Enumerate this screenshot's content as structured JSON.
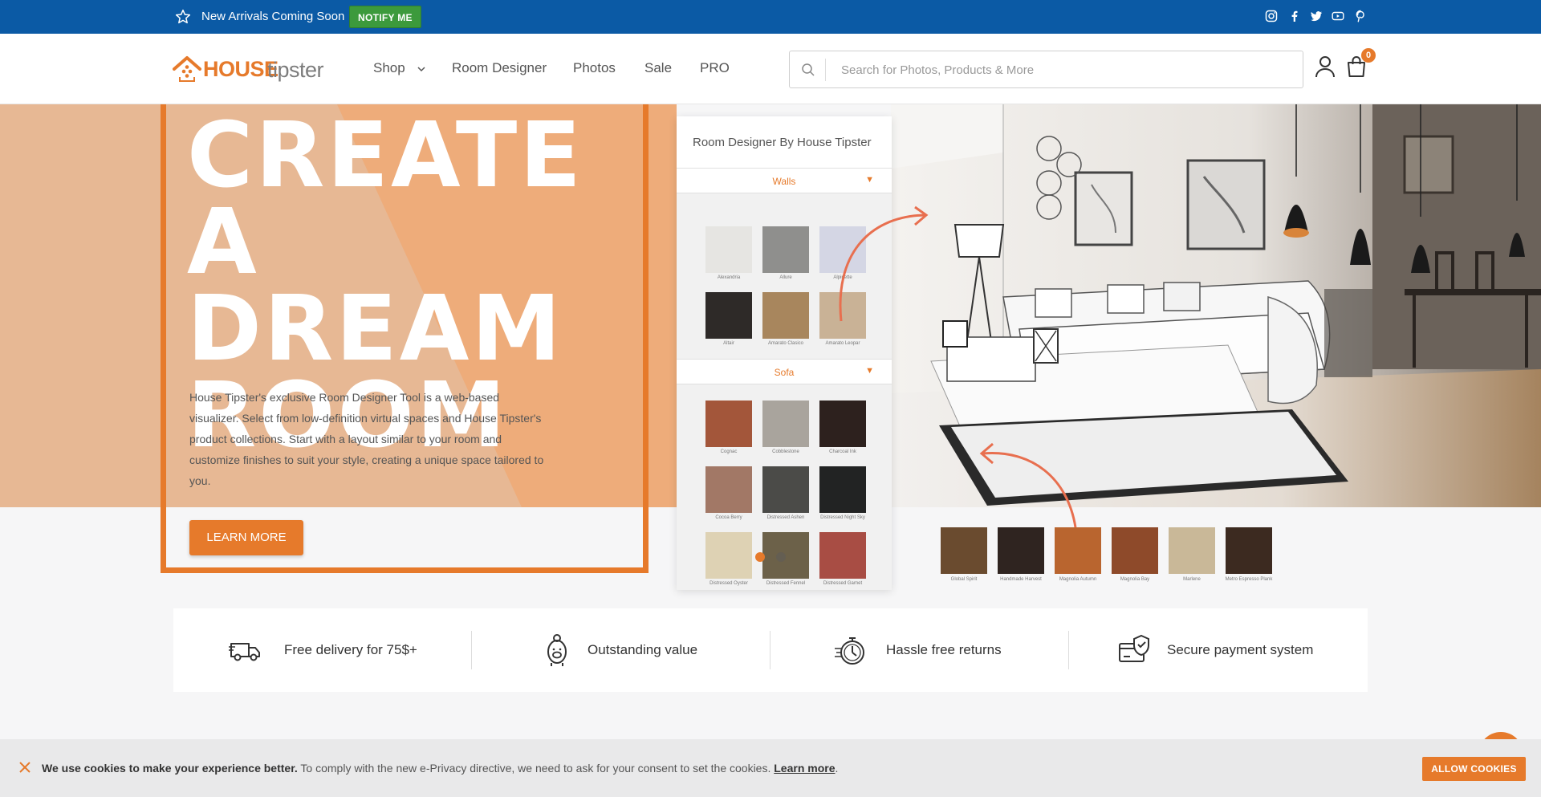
{
  "topbar": {
    "promo_text": "New Arrivals Coming Soon",
    "notify_label": "NOTIFY ME",
    "social": [
      "instagram-icon",
      "facebook-icon",
      "twitter-icon",
      "youtube-icon",
      "pinterest-icon"
    ],
    "bg_color": "#0b5aa5"
  },
  "header": {
    "logo_house": "HOUSE",
    "logo_tipster": "tipster",
    "nav": [
      "Shop",
      "Room Designer",
      "Photos",
      "Sale",
      "PRO"
    ],
    "search_placeholder": "Search for Photos, Products & More",
    "cart_count": "0",
    "accent_color": "#e67a2b"
  },
  "hero": {
    "headline": [
      "CREATE",
      "A DREAM",
      "ROOM"
    ],
    "description": "House Tipster's exclusive Room Designer Tool is a web-based visualizer. Select from low-definition virtual spaces and House Tipster's product collections. Start with a layout similar to your room and customize finishes to suit your style, creating a unique space tailored to you.",
    "cta_label": "LEARN MORE"
  },
  "designer": {
    "title": "Room Designer By House Tipster",
    "walls_label": "Walls",
    "walls": [
      {
        "name": "Alexandria",
        "color": "#e6e5e2"
      },
      {
        "name": "Allure",
        "color": "#8f8f8d"
      },
      {
        "name": "Alpinette",
        "color": "#d4d6e4"
      },
      {
        "name": "Altair",
        "color": "#2e2a28"
      },
      {
        "name": "Amarato Clasico",
        "color": "#a8865d"
      },
      {
        "name": "Amarato Leopar",
        "color": "#c9b296"
      }
    ],
    "sofa_label": "Sofa",
    "sofas": [
      {
        "name": "Cognac",
        "color": "#a3563a"
      },
      {
        "name": "Cobblestone",
        "color": "#a9a49d"
      },
      {
        "name": "Charcoal Ink",
        "color": "#2d211e"
      },
      {
        "name": "Cocoa Berry",
        "color": "#a27866"
      },
      {
        "name": "Distressed Ashen",
        "color": "#4b4b48"
      },
      {
        "name": "Distressed Night Sky",
        "color": "#222323"
      },
      {
        "name": "Distressed Oyster",
        "color": "#ded2b4"
      },
      {
        "name": "Distressed Fennel",
        "color": "#6c6149"
      },
      {
        "name": "Distressed Garnet",
        "color": "#a84d44"
      }
    ],
    "floors": [
      {
        "name": "Global Spirit",
        "color": "#6a4b2f"
      },
      {
        "name": "Handmade Harvest",
        "color": "#2f2420"
      },
      {
        "name": "Magnolia Autumn",
        "color": "#b9652f"
      },
      {
        "name": "Magnolia Bay",
        "color": "#8e4a2a"
      },
      {
        "name": "Marlene",
        "color": "#c9b898"
      },
      {
        "name": "Metro Espresso Plank",
        "color": "#3c2a20"
      }
    ]
  },
  "features": [
    {
      "icon": "delivery-truck-icon",
      "label": "Free delivery for 75$+"
    },
    {
      "icon": "piggy-bank-icon",
      "label": "Outstanding value"
    },
    {
      "icon": "stopwatch-icon",
      "label": "Hassle free returns"
    },
    {
      "icon": "secure-payment-icon",
      "label": "Secure payment system"
    }
  ],
  "cookie": {
    "bold": "We use cookies to make your experience better.",
    "text": " To comply with the new e-Privacy directive, we need to ask for your consent to set the cookies. ",
    "link": "Learn more",
    "end": ".",
    "allow_label": "ALLOW COOKIES"
  }
}
